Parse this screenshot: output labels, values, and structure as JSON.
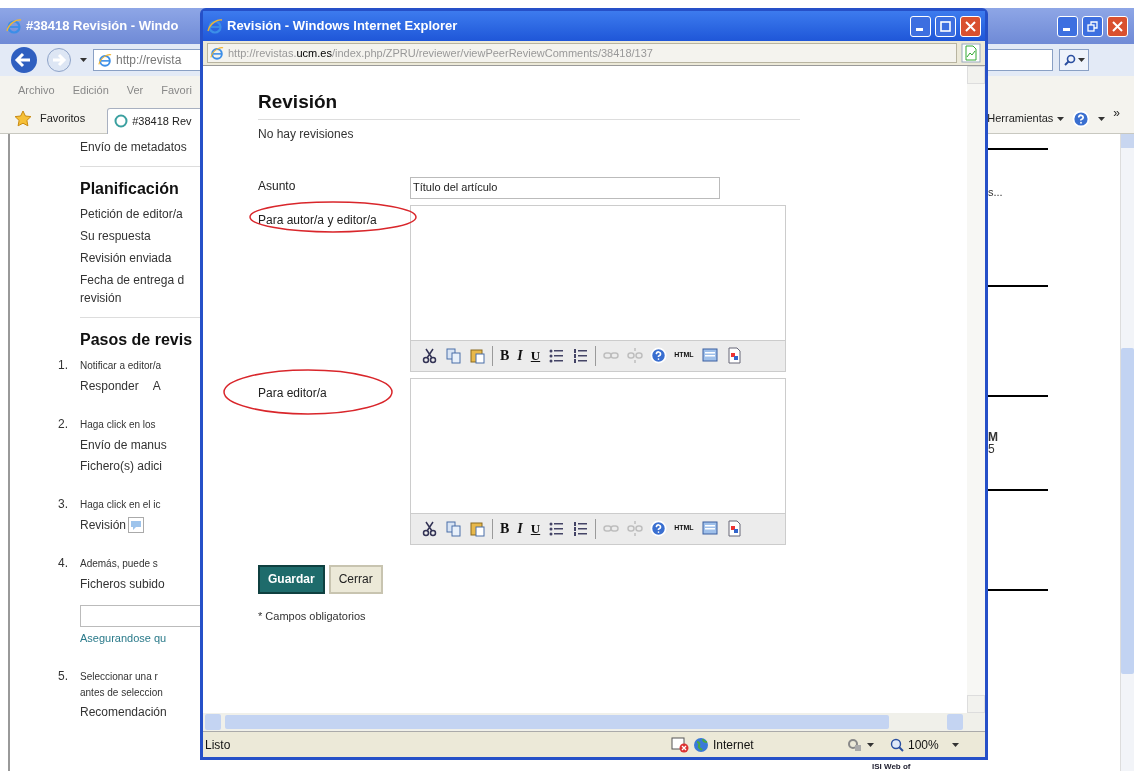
{
  "background_window": {
    "title": "#38418 Revisión - Windo",
    "address": "http://revista",
    "menu": [
      "Archivo",
      "Edición",
      "Ver",
      "Favori"
    ],
    "favorites": "Favoritos",
    "tab": "#38418 Rev",
    "tools": "Herramientas",
    "chevron": "»",
    "content": {
      "top_link": "Envío de metadatos",
      "schedule": {
        "heading": "Planificación",
        "items": [
          "Petición de editor/a",
          "Su respuesta",
          "Revisión enviada",
          "Fecha de entrega d",
          "revisión"
        ]
      },
      "steps": {
        "heading": "Pasos de revis",
        "items": [
          {
            "number": "1.",
            "text": "Notificar a editor/a",
            "links": [
              "Responder",
              "A"
            ]
          },
          {
            "number": "2.",
            "text": "Haga click en los",
            "links": [
              "Envío de manus",
              "Fichero(s) adici"
            ]
          },
          {
            "number": "3.",
            "text": "Haga click en el ic",
            "links": [
              "Revisión"
            ],
            "icon": true
          },
          {
            "number": "4.",
            "text": "Además, puede s",
            "links": [
              "Ficheros subido"
            ],
            "upload_field": true,
            "note": "Asegurandose qu"
          },
          {
            "number": "5.",
            "text": "Seleccionar una r",
            "text_2": "antes de seleccion",
            "links": [
              "Recomendación"
            ]
          }
        ]
      },
      "right_fragments": [
        "s...",
        "M",
        "5"
      ],
      "logo_text": "ISI Web of"
    }
  },
  "popup": {
    "title": "Revisión - Windows Internet Explorer",
    "url": {
      "prefix": "http://revistas.",
      "domain": "ucm.es",
      "path": "/index.php/ZPRU/reviewer/viewPeerReviewComments/38418/137"
    },
    "heading": "Revisión",
    "subheading": "No hay revisiones",
    "subject": {
      "label": "Asunto",
      "value": "Título del artículo"
    },
    "editors": [
      {
        "label": "Para autor/a y editor/a",
        "toolbar": [
          [
            {
              "kind": "cut",
              "disabled": false
            },
            {
              "kind": "copy",
              "disabled": false
            },
            {
              "kind": "paste",
              "disabled": false
            }
          ],
          [
            {
              "kind": "bold",
              "label": "B",
              "disabled": false
            },
            {
              "kind": "italic",
              "label": "I",
              "disabled": false
            },
            {
              "kind": "underline",
              "label": "U",
              "disabled": false
            },
            {
              "kind": "bullets",
              "disabled": false
            },
            {
              "kind": "numbers",
              "disabled": false
            }
          ],
          [
            {
              "kind": "link",
              "disabled": true
            },
            {
              "kind": "unlink",
              "disabled": true
            },
            {
              "kind": "help",
              "disabled": false
            },
            {
              "kind": "html",
              "label": "HTML",
              "disabled": false
            },
            {
              "kind": "panel",
              "disabled": false
            },
            {
              "kind": "image",
              "disabled": false
            }
          ]
        ]
      },
      {
        "label": "Para editor/a",
        "toolbar": [
          [
            {
              "kind": "cut",
              "disabled": false
            },
            {
              "kind": "copy",
              "disabled": false
            },
            {
              "kind": "paste",
              "disabled": false
            }
          ],
          [
            {
              "kind": "bold",
              "label": "B",
              "disabled": false
            },
            {
              "kind": "italic",
              "label": "I",
              "disabled": false
            },
            {
              "kind": "underline",
              "label": "U",
              "disabled": false
            },
            {
              "kind": "bullets",
              "disabled": false
            },
            {
              "kind": "numbers",
              "disabled": false
            }
          ],
          [
            {
              "kind": "link",
              "disabled": true
            },
            {
              "kind": "unlink",
              "disabled": true
            },
            {
              "kind": "help",
              "disabled": false
            },
            {
              "kind": "html",
              "label": "HTML",
              "disabled": false
            },
            {
              "kind": "panel",
              "disabled": false
            },
            {
              "kind": "image",
              "disabled": false
            }
          ]
        ]
      }
    ],
    "buttons": [
      {
        "label": "Guardar",
        "primary": true
      },
      {
        "label": "Cerrar",
        "primary": false
      }
    ],
    "footnote": "* Campos obligatorios",
    "status": {
      "text": "Listo",
      "zone": "Internet",
      "zoom": "100%"
    }
  }
}
